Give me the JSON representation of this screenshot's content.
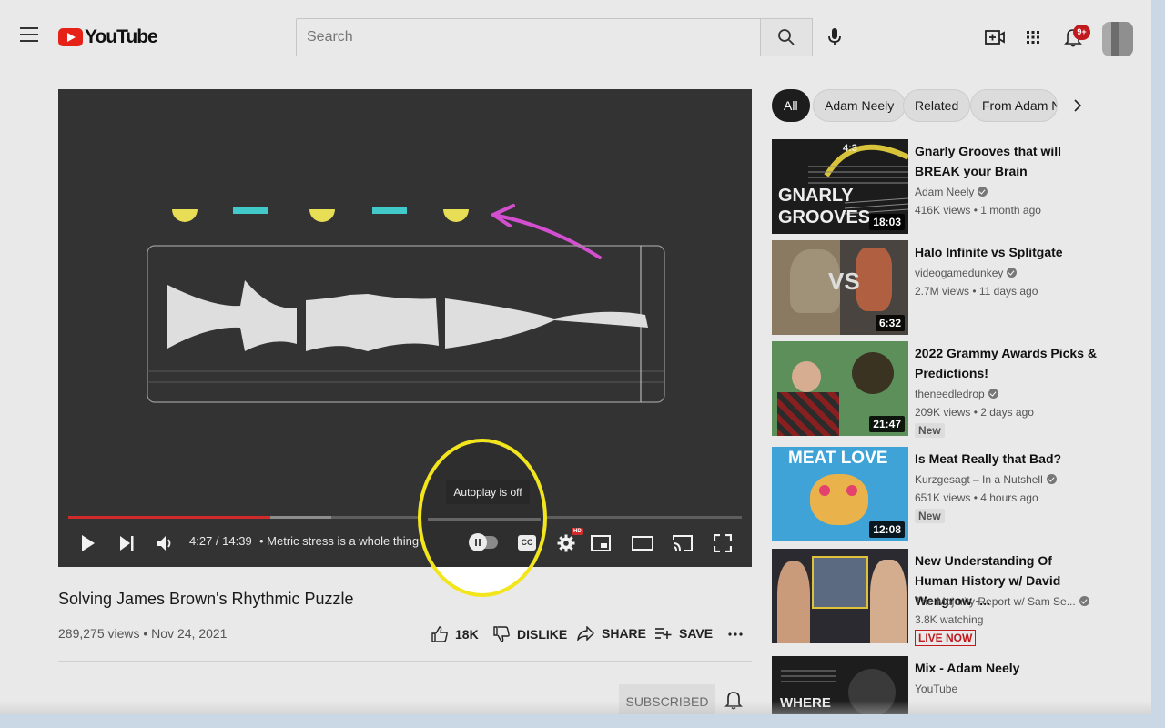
{
  "header": {
    "logo_text": "YouTube",
    "search_placeholder": "Search",
    "notification_count": "9+"
  },
  "player": {
    "time": "4:27 / 14:39",
    "chapter": "• Metric stress is a whole thing",
    "autoplay_tooltip": "Autoplay is off",
    "cc_label": "CC",
    "hd_label": "HD",
    "progress_played": 0.3,
    "progress_buffered": 0.39
  },
  "video": {
    "title": "Solving James Brown's Rhythmic Puzzle",
    "meta": "289,275 views • Nov 24, 2021",
    "like_count": "18K",
    "dislike_label": "DISLIKE",
    "share_label": "SHARE",
    "save_label": "SAVE",
    "subscribed_label": "SUBSCRIBED"
  },
  "chips": [
    "All",
    "Adam Neely",
    "Related",
    "From Adam Neely"
  ],
  "recommendations": [
    {
      "title": "Gnarly Grooves that will BREAK your Brain",
      "channel": "Adam Neely",
      "stats": "416K views • 1 month ago",
      "duration": "18:03",
      "thumb_text": "GNARLY GROOVES",
      "thumb_meter": "4:3"
    },
    {
      "title": "Halo Infinite vs Splitgate",
      "channel": "videogamedunkey",
      "stats": "2.7M views • 11 days ago",
      "duration": "6:32",
      "thumb_text": "VS"
    },
    {
      "title": "2022 Grammy Awards Picks & Predictions!",
      "channel": "theneedledrop",
      "stats": "209K views • 2 days ago",
      "duration": "21:47",
      "badge": "New"
    },
    {
      "title": "Is Meat Really that Bad?",
      "channel": "Kurzgesagt – In a Nutshell",
      "stats": "651K views • 4 hours ago",
      "duration": "12:08",
      "badge": "New",
      "thumb_text": "MEAT LOVE"
    },
    {
      "title": "New Understanding Of Human History w/ David Wengrow -...",
      "channel": "The Majority Report w/ Sam Se...",
      "stats": "3.8K watching",
      "badge": "LIVE NOW"
    },
    {
      "title": "Mix - Adam Neely",
      "channel": "YouTube",
      "thumb_text": "WHERE"
    }
  ]
}
